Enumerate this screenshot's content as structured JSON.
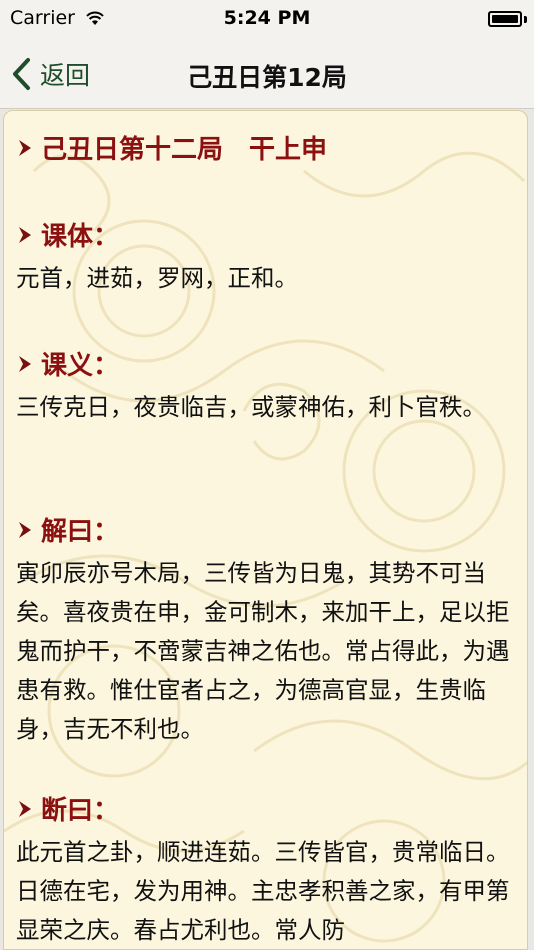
{
  "status_bar": {
    "carrier": "Carrier",
    "time": "5:24 PM"
  },
  "nav": {
    "back_label": "返回",
    "title": "己丑日第12局"
  },
  "content": {
    "title": "己丑日第十二局　干上申",
    "sections": [
      {
        "heading": "课体：",
        "text": "元首，进茹，罗网，正和。"
      },
      {
        "heading": "课义：",
        "text": "三传克日，夜贵临吉，或蒙神佑，利卜官秩。"
      },
      {
        "heading": "解曰：",
        "text": "寅卯辰亦号木局，三传皆为日鬼，其势不可当矣。喜夜贵在申，金可制木，来加干上，足以拒鬼而护干，不啻蒙吉神之佑也。常占得此，为遇患有救。惟仕宦者占之，为德高官显，生贵临身，吉无不利也。"
      },
      {
        "heading": "断曰：",
        "text": "此元首之卦，顺进连茹。三传皆官，贵常临日。日德在宅，发为用神。主忠孝积善之家，有甲第显荣之庆。春占尤利也。常人防"
      }
    ]
  }
}
